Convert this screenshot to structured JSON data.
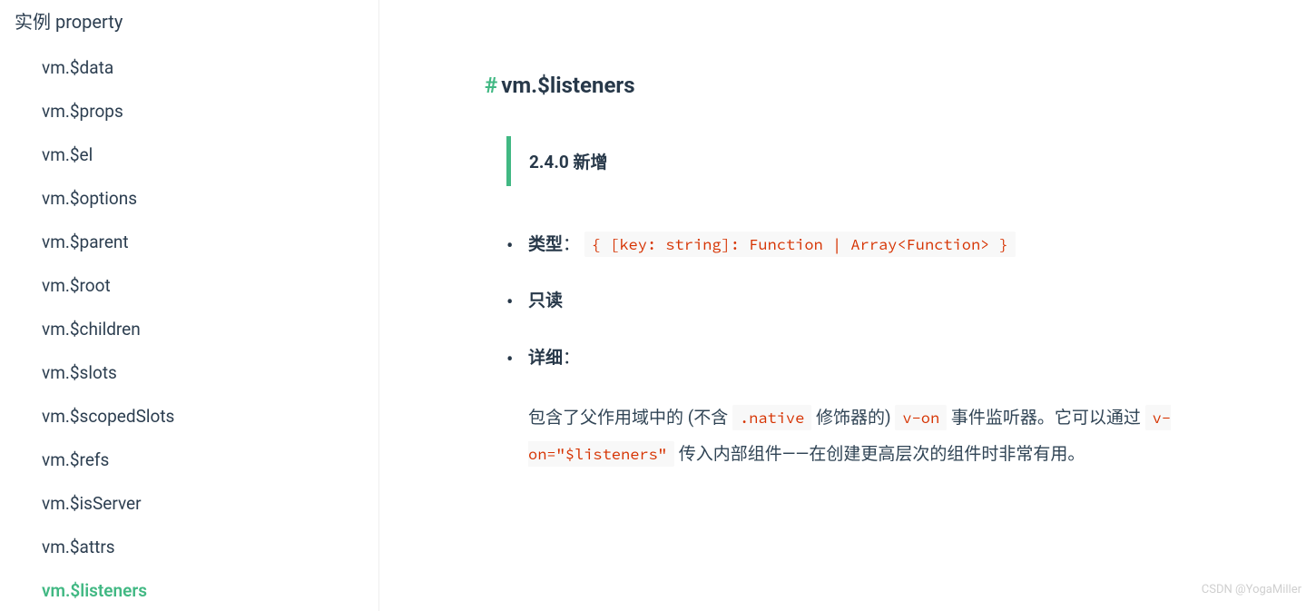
{
  "sidebar": {
    "section_title": "实例 property",
    "items": [
      {
        "label": "vm.$data",
        "active": false
      },
      {
        "label": "vm.$props",
        "active": false
      },
      {
        "label": "vm.$el",
        "active": false
      },
      {
        "label": "vm.$options",
        "active": false
      },
      {
        "label": "vm.$parent",
        "active": false
      },
      {
        "label": "vm.$root",
        "active": false
      },
      {
        "label": "vm.$children",
        "active": false
      },
      {
        "label": "vm.$slots",
        "active": false
      },
      {
        "label": "vm.$scopedSlots",
        "active": false
      },
      {
        "label": "vm.$refs",
        "active": false
      },
      {
        "label": "vm.$isServer",
        "active": false
      },
      {
        "label": "vm.$attrs",
        "active": false
      },
      {
        "label": "vm.$listeners",
        "active": true
      }
    ]
  },
  "content": {
    "hash": "#",
    "title": "vm.$listeners",
    "notice": "2.4.0 新增",
    "type_label": "类型",
    "colon": "：",
    "type_code": "{ [key: string]: Function | Array<Function> }",
    "readonly_label": "只读",
    "detail_label": "详细",
    "detail": {
      "p1a": "包含了父作用域中的 (不含 ",
      "code1": ".native",
      "p1b": " 修饰器的) ",
      "code2": "v-on",
      "p1c": " 事件监听器。它可以通过 ",
      "code3": "v-on=\"$listeners\"",
      "p1d": " 传入内部组件——在创建更高层次的组件时非常有用。"
    }
  },
  "watermark": "CSDN @YogaMiller"
}
